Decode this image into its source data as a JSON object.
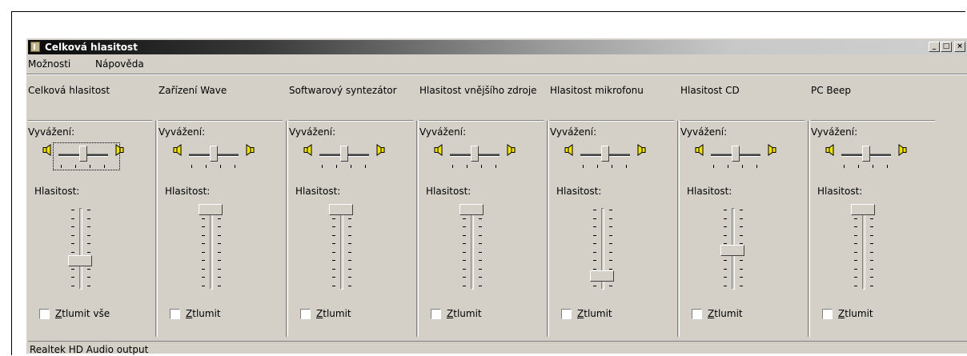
{
  "window": {
    "title": "Celková hlasitost"
  },
  "titlebar_buttons": {
    "minimize": "_",
    "maximize": "□",
    "close": "×"
  },
  "menu": {
    "options": "Možnosti",
    "help": "Nápověda"
  },
  "labels": {
    "balance": "Vyvážení:",
    "volume": "Hlasitost:"
  },
  "channels": [
    {
      "title": "Celková hlasitost",
      "balance": 0.5,
      "volume": 0.3,
      "mute_label": "Ztlumit vše",
      "muted": false
    },
    {
      "title": "Zařízení Wave",
      "balance": 0.5,
      "volume": 1.0,
      "mute_label": "Ztlumit",
      "muted": false
    },
    {
      "title": "Softwarový syntezátor",
      "balance": 0.5,
      "volume": 1.0,
      "mute_label": "Ztlumit",
      "muted": false
    },
    {
      "title": "Hlasitost vnějšího zdroje",
      "balance": 0.5,
      "volume": 1.0,
      "mute_label": "Ztlumit",
      "muted": false
    },
    {
      "title": "Hlasitost mikrofonu",
      "balance": 0.5,
      "volume": 0.1,
      "mute_label": "Ztlumit",
      "muted": false
    },
    {
      "title": "Hlasitost CD",
      "balance": 0.5,
      "volume": 0.45,
      "mute_label": "Ztlumit",
      "muted": false
    },
    {
      "title": "PC Beep",
      "balance": 0.5,
      "volume": 1.0,
      "mute_label": "Ztlumit",
      "muted": false
    }
  ],
  "status": {
    "text": "Realtek HD Audio output"
  },
  "icons": {
    "app": "volume-control-icon",
    "speaker_left": "speaker-left-icon",
    "speaker_right": "speaker-right-icon"
  }
}
